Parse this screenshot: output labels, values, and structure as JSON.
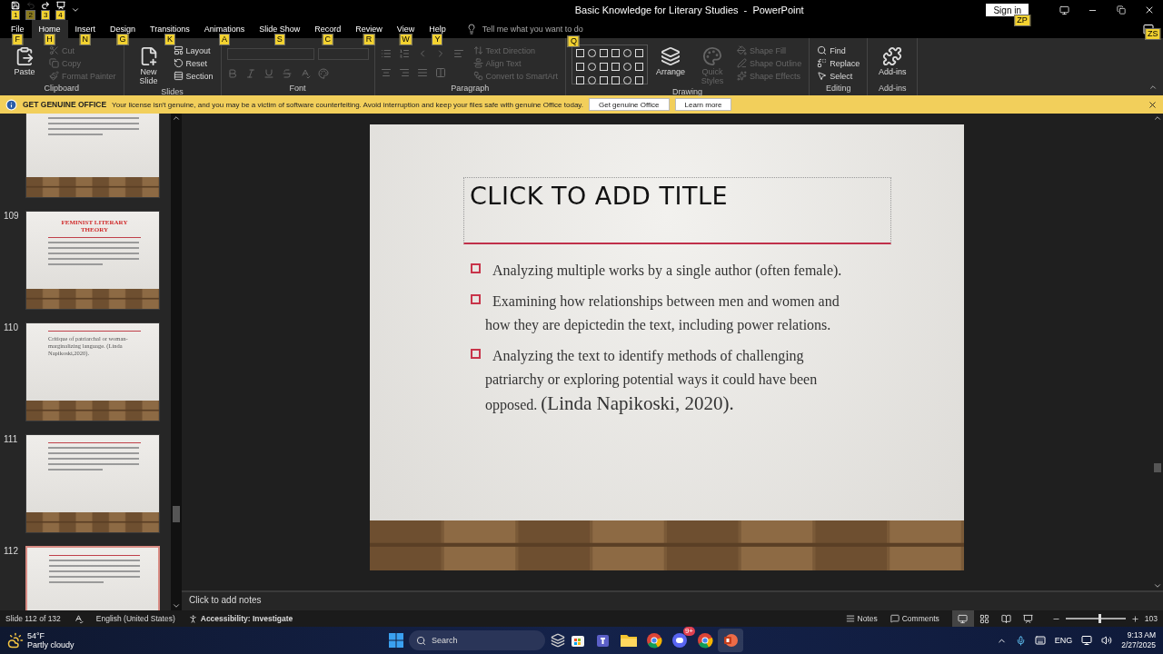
{
  "window": {
    "title": "Basic Knowledge for Literary Studies  -  PowerPoint",
    "sign_in": "Sign in",
    "sign_in_keytip": "ZP",
    "comments_keytip": "ZS"
  },
  "quick_access": [
    {
      "kind": "save",
      "keytip": "1",
      "disabled": false
    },
    {
      "kind": "undo",
      "keytip": "2",
      "disabled": true
    },
    {
      "kind": "redo",
      "keytip": "3",
      "disabled": false
    },
    {
      "kind": "present",
      "keytip": "4",
      "disabled": false
    }
  ],
  "tabs": [
    {
      "label": "File",
      "keytip": "F",
      "selected": false
    },
    {
      "label": "Home",
      "keytip": "H",
      "selected": true
    },
    {
      "label": "Insert",
      "keytip": "N",
      "selected": false
    },
    {
      "label": "Design",
      "keytip": "G",
      "selected": false
    },
    {
      "label": "Transitions",
      "keytip": "K",
      "selected": false
    },
    {
      "label": "Animations",
      "keytip": "A",
      "selected": false
    },
    {
      "label": "Slide Show",
      "keytip": "S",
      "selected": false
    },
    {
      "label": "Record",
      "keytip": "C",
      "selected": false
    },
    {
      "label": "Review",
      "keytip": "R",
      "selected": false
    },
    {
      "label": "View",
      "keytip": "W",
      "selected": false
    },
    {
      "label": "Help",
      "keytip": "Y",
      "selected": false
    }
  ],
  "tell_me": {
    "placeholder": "Tell me what you want to do",
    "keytip": "Q"
  },
  "ribbon": [
    {
      "label": "Clipboard",
      "kind": "buttons",
      "items": [
        {
          "kind": "large",
          "label": "Paste",
          "disabled": false
        },
        {
          "kind": "small",
          "label": "Cut",
          "disabled": true
        },
        {
          "kind": "small",
          "label": "Copy",
          "disabled": true
        },
        {
          "kind": "small",
          "label": "Format Painter",
          "disabled": true
        }
      ]
    },
    {
      "label": "Slides",
      "kind": "buttons",
      "items": [
        {
          "kind": "large",
          "label": "New Slide",
          "disabled": false
        },
        {
          "kind": "small",
          "label": "Layout",
          "disabled": false
        },
        {
          "kind": "small",
          "label": "Reset",
          "disabled": false
        },
        {
          "kind": "small",
          "label": "Section",
          "disabled": false
        }
      ]
    },
    {
      "label": "Font",
      "kind": "font"
    },
    {
      "label": "Paragraph",
      "kind": "paragraph",
      "items": [
        {
          "kind": "small",
          "label": "Text Direction",
          "disabled": true
        },
        {
          "kind": "small",
          "label": "Align Text",
          "disabled": true
        },
        {
          "kind": "small",
          "label": "Convert to SmartArt",
          "disabled": true
        }
      ]
    },
    {
      "label": "Drawing",
      "kind": "drawing",
      "items": [
        {
          "kind": "large",
          "label": "Arrange",
          "disabled": false
        },
        {
          "kind": "large",
          "label": "Quick Styles",
          "disabled": true
        },
        {
          "kind": "small",
          "label": "Shape Fill",
          "disabled": true
        },
        {
          "kind": "small",
          "label": "Shape Outline",
          "disabled": true
        },
        {
          "kind": "small",
          "label": "Shape Effects",
          "disabled": true
        }
      ]
    },
    {
      "label": "Editing",
      "kind": "buttons",
      "items": [
        {
          "kind": "small",
          "label": "Find",
          "disabled": false
        },
        {
          "kind": "small",
          "label": "Replace",
          "disabled": false
        },
        {
          "kind": "small",
          "label": "Select",
          "disabled": false
        }
      ]
    },
    {
      "label": "Add-ins",
      "kind": "buttons",
      "items": [
        {
          "kind": "large",
          "label": "Add-ins",
          "disabled": false
        }
      ]
    }
  ],
  "notice": {
    "title": "GET GENUINE OFFICE",
    "message": "Your license isn't genuine, and you may be a victim of software counterfeiting. Avoid interruption and keep your files safe with genuine Office today.",
    "buttons": [
      "Get genuine Office",
      "Learn more"
    ]
  },
  "thumbnails": [
    {
      "selected": false
    },
    {
      "number": "109",
      "selected": false,
      "title": "FEMINIST LITERARY THEORY"
    },
    {
      "number": "110",
      "selected": false,
      "text": "Critique of patriarchal or woman-marginalizing language.  (Linda Napikoski,2020)."
    },
    {
      "number": "111",
      "selected": false
    },
    {
      "number": "112",
      "selected": true
    }
  ],
  "slide": {
    "title_placeholder": "CLICK TO ADD TITLE",
    "bullets": [
      {
        "text": "Analyzing multiple works by a single author (often female)."
      },
      {
        "text": "Examining how relationships between men and women and how they are depictedin the text, including power relations."
      },
      {
        "text": "Analyzing the text to identify methods of challenging patriarchy or exploring potential ways it could have been opposed.",
        "citation": "(Linda Napikoski, 2020)."
      }
    ]
  },
  "notes": {
    "placeholder": "Click to add notes"
  },
  "status_bar": {
    "slide": "Slide 112 of 132",
    "language": "English (United States)",
    "accessibility": "Accessibility: Investigate",
    "notes": "Notes",
    "comments": "Comments",
    "views": [
      {
        "kind": "normal",
        "selected": true
      },
      {
        "kind": "sorter",
        "selected": false
      },
      {
        "kind": "reading",
        "selected": false
      },
      {
        "kind": "slideshow",
        "selected": false
      }
    ],
    "zoom": {
      "level": 0.55,
      "reading": "103"
    }
  },
  "taskbar": {
    "weather": {
      "temp": "54°F",
      "condition": "Partly cloudy"
    },
    "search": {
      "placeholder": "Search"
    },
    "apps": [
      {
        "kind": "store",
        "selected": false
      },
      {
        "kind": "teams",
        "selected": false
      },
      {
        "kind": "files",
        "selected": false
      },
      {
        "kind": "chrome",
        "selected": false
      },
      {
        "kind": "discord",
        "selected": false,
        "badge": "9+"
      },
      {
        "kind": "chrome",
        "selected": false
      },
      {
        "kind": "powerpoint",
        "selected": true
      }
    ],
    "language": "ENG",
    "time": "9:13 AM",
    "date": "2/27/2025"
  }
}
